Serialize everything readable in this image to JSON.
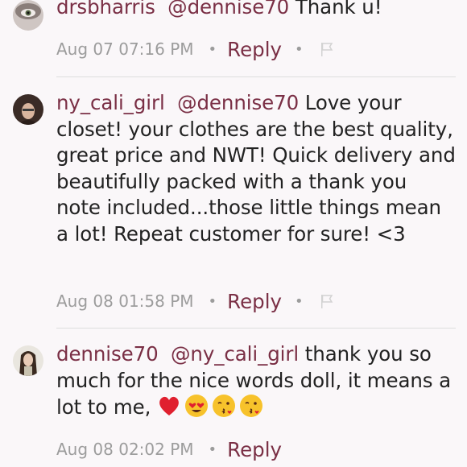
{
  "comments": [
    {
      "username": "drsbharris",
      "mention": "@dennise70",
      "text": " Thank u!",
      "timestamp": "Aug 07 07:16 PM",
      "reply_label": "Reply",
      "has_flag": true
    },
    {
      "username": "ny_cali_girl",
      "mention": "@dennise70",
      "text": " Love your closet! your clothes are the best quality, great price and NWT! Quick delivery and beautifully packed with a thank you note included...those little things mean a lot! Repeat customer for sure! <3",
      "timestamp": "Aug 08 01:58 PM",
      "reply_label": "Reply",
      "has_flag": true
    },
    {
      "username": "dennise70",
      "mention": "@ny_cali_girl",
      "text": " thank you so much for the nice words doll, it means a lot to me,",
      "emojis": [
        "red-heart",
        "heart-eyes",
        "kissing-face",
        "kissing-face"
      ],
      "timestamp": "Aug 08 02:02 PM",
      "reply_label": "Reply",
      "has_flag": false
    }
  ],
  "colors": {
    "accent": "#7a2f45",
    "meta_text": "#9c9c9c",
    "background": "#faf7f9",
    "divider": "#dddddd"
  }
}
